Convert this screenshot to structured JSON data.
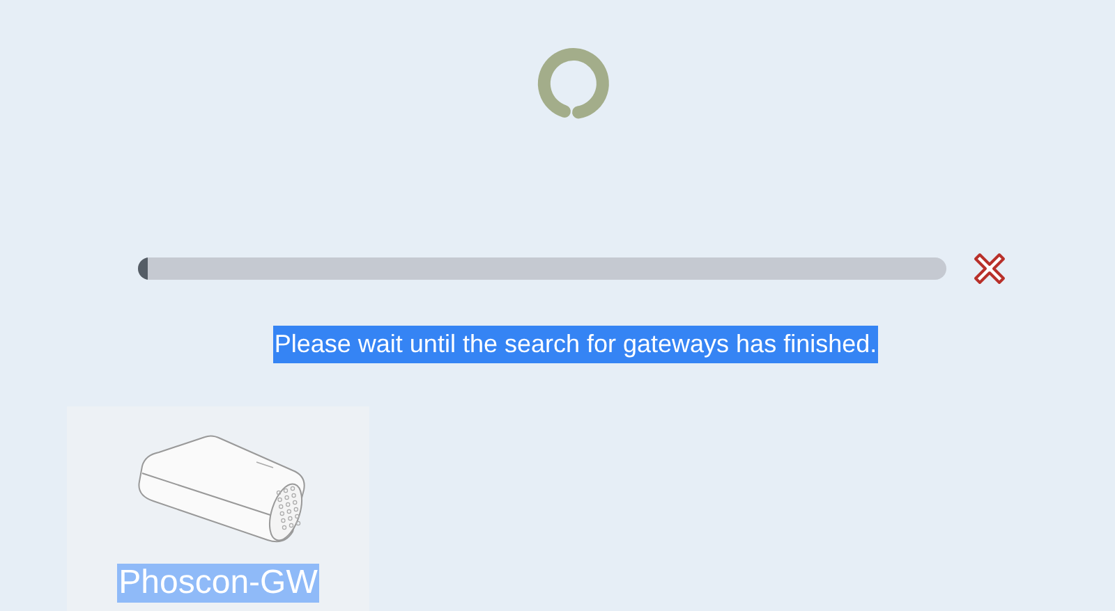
{
  "search": {
    "level": 0.012,
    "message": "Please wait until the search for gateways has finished.",
    "message_highlighted": true
  },
  "gateways": [
    {
      "name": "Phoscon-GW",
      "highlighted": true
    }
  ]
}
